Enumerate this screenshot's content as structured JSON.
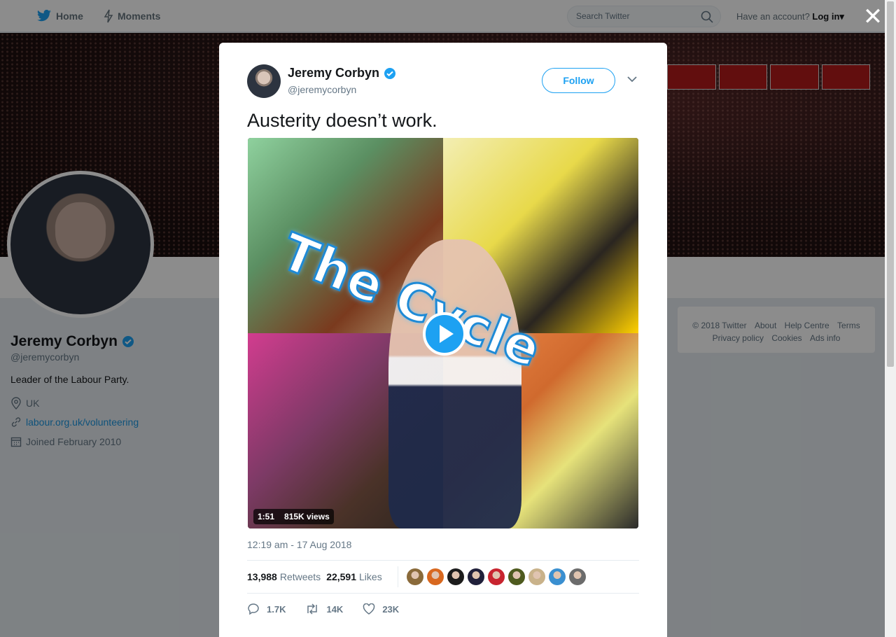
{
  "nav": {
    "home": "Home",
    "moments": "Moments",
    "search_placeholder": "Search Twitter",
    "account_prompt": "Have an account?",
    "login": "Log in"
  },
  "profile": {
    "name": "Jeremy Corbyn",
    "handle": "@jeremycorbyn",
    "bio": "Leader of the Labour Party.",
    "location": "UK",
    "url": "labour.org.uk/volunteering",
    "joined": "Joined February 2010"
  },
  "footer": {
    "links": [
      "© 2018 Twitter",
      "About",
      "Help Centre",
      "Terms",
      "Privacy policy",
      "Cookies",
      "Ads info"
    ]
  },
  "tweet": {
    "name": "Jeremy Corbyn",
    "handle": "@jeremycorbyn",
    "follow_label": "Follow",
    "text": "Austerity doesn’t work.",
    "video_title": "The Cycle",
    "duration": "1:51",
    "views": "815K views",
    "timestamp": "12:19 am - 17 Aug 2018",
    "retweets_count": "13,988",
    "retweets_label": "Retweets",
    "likes_count": "22,591",
    "likes_label": "Likes",
    "replies_action": "1.7K",
    "retweets_action": "14K",
    "likes_action": "23K"
  },
  "colors": {
    "accent": "#1da1f2",
    "liker_avatars": [
      "#8a6a3a",
      "#d8681f",
      "#1c1c1c",
      "#20203a",
      "#c8242f",
      "#4e5a1e",
      "#c9b28a",
      "#3a8fd0",
      "#6c6c6c"
    ]
  }
}
